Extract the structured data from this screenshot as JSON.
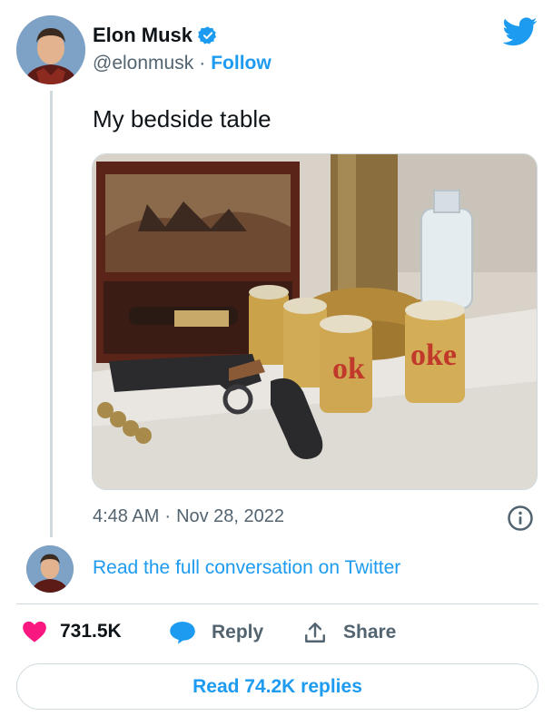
{
  "tweet": {
    "author_name": "Elon Musk",
    "handle": "@elonmusk",
    "separator": "·",
    "follow_label": "Follow",
    "text": "My bedside table",
    "time": "4:48 AM",
    "date": "Nov 28, 2022"
  },
  "conversation": {
    "link_label": "Read the full conversation on Twitter"
  },
  "actions": {
    "likes": "731.5K",
    "reply_label": "Reply",
    "share_label": "Share"
  },
  "read_replies_label": "Read 74.2K replies",
  "icons": {
    "verified": "verified-badge-icon",
    "brand": "twitter-bird-icon",
    "info": "info-icon",
    "like": "heart-icon",
    "reply": "speech-bubble-icon",
    "share": "share-upload-icon"
  },
  "colors": {
    "accent": "#1d9bf0",
    "like": "#f91880",
    "text": "#0f1419",
    "muted": "#536471",
    "border": "#cfd9de"
  }
}
